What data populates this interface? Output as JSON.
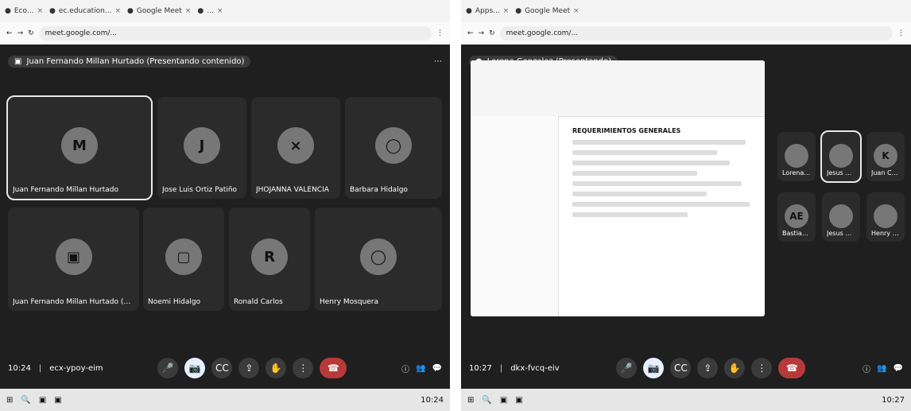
{
  "left": {
    "browser": {
      "tabs": [
        {
          "label": "Eco...",
          "icon": "tab-icon"
        },
        {
          "label": "ec.education...",
          "icon": "tab-icon"
        },
        {
          "label": "Google Meet",
          "icon": "tab-icon"
        },
        {
          "label": "...",
          "icon": "tab-icon"
        }
      ],
      "url": "meet.google.com/..."
    },
    "meet": {
      "presenting_text": "Juan Fernando Millan Hurtado (Presentando contenido)",
      "tiles": [
        {
          "name": "Juan Fernando Millan Hurtado",
          "initial": "M",
          "active": true
        },
        {
          "name": "Jose Luis Ortiz Patiño",
          "initial": "J",
          "active": false
        },
        {
          "name": "JHOJANNA VALENCIA",
          "initial": "",
          "active": false
        },
        {
          "name": "Barbara Hidalgo",
          "initial": "",
          "active": false
        },
        {
          "name": "Juan Fernando Millan Hurtado (presentando)",
          "initial": "",
          "active": false
        },
        {
          "name": "Noemi Hidalgo",
          "initial": "",
          "active": false
        },
        {
          "name": "Ronald Carlos",
          "initial": "R",
          "active": false
        },
        {
          "name": "Henry Mosquera",
          "initial": "",
          "active": false
        }
      ],
      "time": "10:24",
      "meeting_code": "ecx-ypoy-eim"
    },
    "taskbar": {
      "right_text": "10:24"
    }
  },
  "right": {
    "browser": {
      "tabs": [
        {
          "label": "Apps...",
          "icon": "tab-icon"
        },
        {
          "label": "Google Meet",
          "icon": "tab-icon"
        }
      ],
      "url": "meet.google.com/..."
    },
    "meet": {
      "presenter": "Lorena Gonzalez (Presentando)",
      "doc_title": "REQUERIMIENTOS GENERALES",
      "sidebar_participants": [
        {
          "name": "Lorena Gonzalez",
          "initial": ""
        },
        {
          "name": "Jesus Diego",
          "initial": ""
        },
        {
          "name": "Juan Carlos",
          "initial": "K"
        },
        {
          "name": "Bastian Torres",
          "initial": "AE"
        },
        {
          "name": "Jesus Galindo",
          "initial": ""
        },
        {
          "name": "Henry Mosquera",
          "initial": ""
        }
      ],
      "time": "10:27",
      "meeting_code": "dkx-fvcq-eiv"
    },
    "taskbar": {
      "right_text": "10:27"
    }
  }
}
